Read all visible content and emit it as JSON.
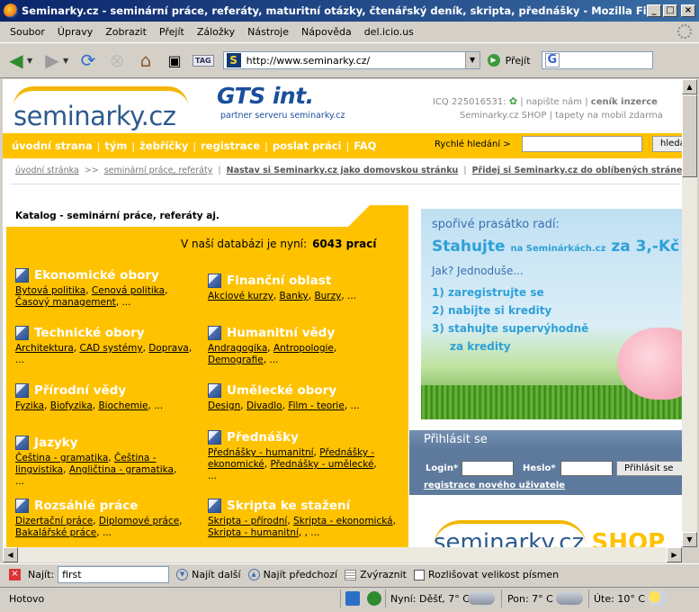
{
  "window": {
    "title": "Seminarky.cz - seminární práce, referáty, maturitní otázky, čtenářský deník, skripta, přednášky - Mozilla Firefox"
  },
  "menu": [
    "Soubor",
    "Úpravy",
    "Zobrazit",
    "Přejít",
    "Záložky",
    "Nástroje",
    "Nápověda",
    "del.icio.us"
  ],
  "toolbar": {
    "url": "http://www.seminarky.cz/",
    "go_label": "Přejít",
    "tag_label": "TAG",
    "search_logo": "G"
  },
  "header": {
    "logo": "seminarky.cz",
    "partner_name": "GTS int.",
    "partner_sub": "partner serveru seminarky.cz",
    "icq": "ICQ 225016531:",
    "links_row1": [
      "napište nám",
      "ceník inzerce"
    ],
    "links_row2": [
      "Seminarky.cz SHOP",
      "tapety na mobil zdarma"
    ]
  },
  "nav": {
    "links": [
      "úvodní strana",
      "tým",
      "žebříčky",
      "registrace",
      "poslat práci",
      "FAQ"
    ],
    "quick_search_label": "Rychlé hledání >",
    "search_button": "hledat"
  },
  "breadcrumb": {
    "home": "úvodní stránka",
    "sep": ">>",
    "current": "seminární práce, referáty",
    "link1": "Nastav si Seminarky.cz jako domovskou stránku",
    "link2": "Přidej si Seminarky.cz do oblíbených stránek"
  },
  "catalog": {
    "title": "Katalog - seminární práce, referáty aj.",
    "db_text": "V naší databázi je nyní:",
    "db_count": "6043 prací",
    "categories": [
      {
        "title": "Ekonomické obory",
        "links": [
          "Bytová politika",
          "Cenová politika",
          "Časový management"
        ]
      },
      {
        "title": "Finanční oblast",
        "links": [
          "Akciové kurzy",
          "Banky",
          "Burzy"
        ]
      },
      {
        "title": "Technické obory",
        "links": [
          "Architektura",
          "CAD systémy",
          "Doprava"
        ]
      },
      {
        "title": "Humanitní vědy",
        "links": [
          "Andragogika",
          "Antropologie",
          "Demografie"
        ]
      },
      {
        "title": "Přírodní vědy",
        "links": [
          "Fyzika",
          "Biofyzika",
          "Biochemie"
        ]
      },
      {
        "title": "Umělecké obory",
        "links": [
          "Design",
          "Divadlo",
          "Film - teorie"
        ]
      },
      {
        "title": "Jazyky",
        "links": [
          "Čeština - gramatika",
          "Čeština - lingvistika",
          "Angličtina - gramatika"
        ]
      },
      {
        "title": "Přednášky",
        "links": [
          "Přednášky - humanitní",
          "Přednášky - ekonomické",
          "Přednášky - umělecké"
        ]
      },
      {
        "title": "Rozsáhlé práce",
        "links": [
          "Dizertační práce",
          "Diplomové práce",
          "Bakalářské práce"
        ]
      },
      {
        "title": "Skripta ke stažení",
        "links": [
          "Skripta - přírodní",
          "Skripta - ekonomická",
          "Skripta - humanitní"
        ]
      }
    ]
  },
  "banner": {
    "line1": "spořivé prasátko radí:",
    "line2a": "Stahujte",
    "line2b": "na Seminárkách.cz",
    "line2c": "za 3,-Kč",
    "line3": "Jak? Jednoduše...",
    "steps": [
      "1) zaregistrujte se",
      "2) nabijte si kredity",
      "3) stahujte supervýhodně",
      "za kredity"
    ]
  },
  "login": {
    "title": "Přihlásit se",
    "login_label": "Login*",
    "password_label": "Heslo*",
    "submit": "Přihlásit se",
    "register": "registrace nového uživatele"
  },
  "shop": {
    "text": "seminarky.cz",
    "shop_word": "SHOP"
  },
  "findbar": {
    "label": "Najít:",
    "value": "first",
    "next": "Najít další",
    "prev": "Najít předchozí",
    "highlight": "Zvýraznit",
    "match_case": "Rozlišovat velikost písmen"
  },
  "status": {
    "text": "Hotovo",
    "weather_now": "Nyní: Děšť, 7° C",
    "weather_mon": "Pon: 7° C",
    "weather_tue": "Úte: 10° C"
  }
}
